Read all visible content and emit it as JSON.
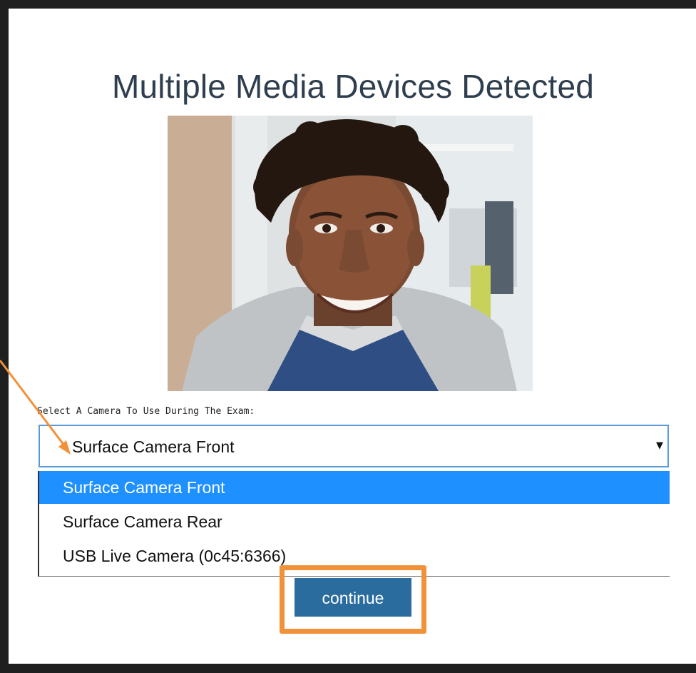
{
  "dialog": {
    "title": "Multiple Media Devices Detected"
  },
  "camera_select": {
    "label": "Select A Camera To Use During The Exam:",
    "value": "Surface Camera Front",
    "options": [
      {
        "label": "Surface Camera Front",
        "selected": true
      },
      {
        "label": "Surface Camera Rear",
        "selected": false
      },
      {
        "label": "USB Live Camera (0c45:6366)",
        "selected": false
      }
    ]
  },
  "actions": {
    "continue_label": "continue"
  },
  "colors": {
    "title_text": "#2e3e4e",
    "select_border": "#5b9ad5",
    "option_highlight": "#1e90ff",
    "button_bg": "#2b6c9e",
    "annotation_orange": "#f1913a"
  },
  "icons": {
    "select_caret": "triangle-down-icon"
  }
}
